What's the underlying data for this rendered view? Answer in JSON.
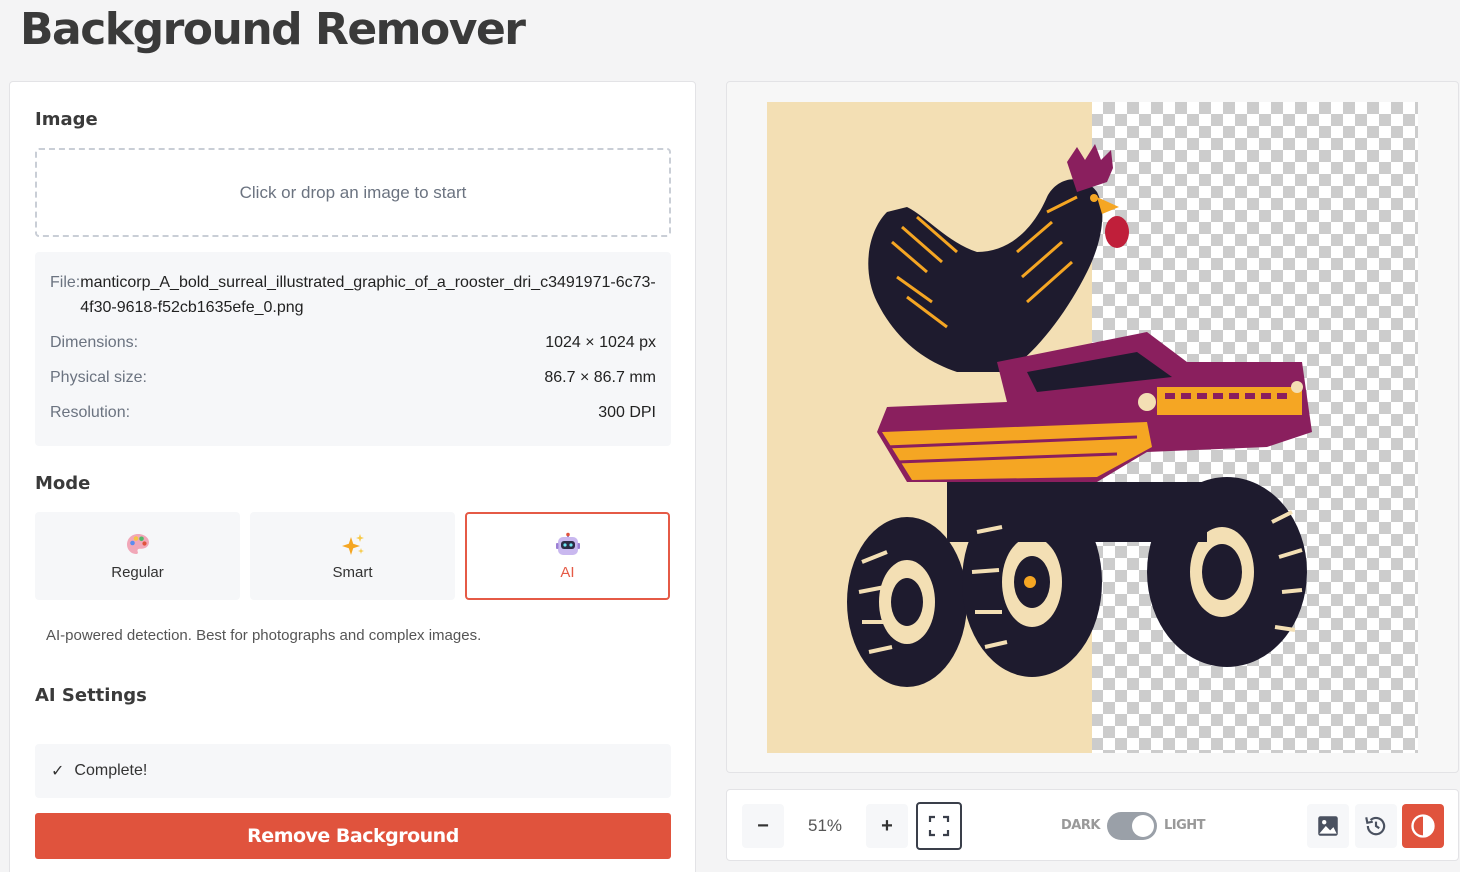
{
  "app": {
    "title": "Background Remover"
  },
  "image_section": {
    "title": "Image",
    "dropzone_text": "Click or drop an image to start",
    "file_label": "File:",
    "file_name": "manticorp_A_bold_surreal_illustrated_graphic_of_a_rooster_dri_c3491971-6c73-4f30-9618-f52cb1635efe_0.png",
    "rows": [
      {
        "label": "Dimensions:",
        "value": "1024 × 1024 px"
      },
      {
        "label": "Physical size:",
        "value": "86.7 × 86.7 mm"
      },
      {
        "label": "Resolution:",
        "value": "300 DPI"
      }
    ]
  },
  "mode_section": {
    "title": "Mode",
    "options": [
      {
        "label": "Regular",
        "icon": "palette-icon",
        "active": false
      },
      {
        "label": "Smart",
        "icon": "sparkles-icon",
        "active": false
      },
      {
        "label": "AI",
        "icon": "robot-icon",
        "active": true
      }
    ],
    "description": "AI-powered detection. Best for photographs and complex images."
  },
  "ai_settings": {
    "title": "AI Settings",
    "status_check": "✓",
    "status_text": "Complete!"
  },
  "actions": {
    "remove_label": "Remove Background"
  },
  "toolbar": {
    "zoom_out": "−",
    "zoom_level": "51%",
    "zoom_in": "+",
    "dark_label": "DARK",
    "light_label": "LIGHT",
    "theme": "light"
  },
  "colors": {
    "accent": "#e0533d",
    "paper": "#f3dfb4",
    "rooster": "#1e1b2e",
    "truck": "#8a1f5e",
    "stripes": "#f5a623"
  }
}
